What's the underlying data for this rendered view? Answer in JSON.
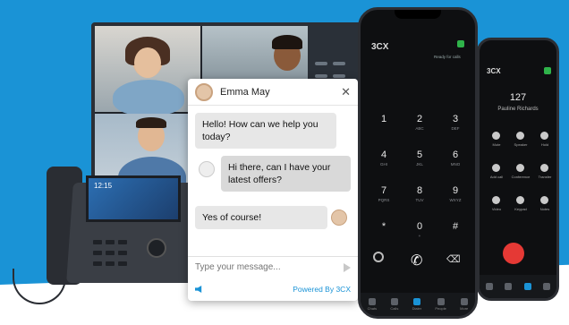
{
  "chat": {
    "agent_name": "Emma May",
    "close_glyph": "✕",
    "messages": [
      {
        "from": "agent",
        "text": "Hello! How can we help you today?"
      },
      {
        "from": "visitor",
        "text": "Hi there, can I have your latest offers?"
      },
      {
        "from": "agent",
        "text": "Yes of course!"
      }
    ],
    "input_placeholder": "Type your message...",
    "powered_by": "Powered By 3CX"
  },
  "desk_phone": {
    "screen_time": "12:15"
  },
  "main_phone": {
    "brand": "3CX",
    "status": "Ready for calls",
    "keys": [
      {
        "digit": "1",
        "letters": ""
      },
      {
        "digit": "2",
        "letters": "ABC"
      },
      {
        "digit": "3",
        "letters": "DEF"
      },
      {
        "digit": "4",
        "letters": "GHI"
      },
      {
        "digit": "5",
        "letters": "JKL"
      },
      {
        "digit": "6",
        "letters": "MNO"
      },
      {
        "digit": "7",
        "letters": "PQRS"
      },
      {
        "digit": "8",
        "letters": "TUV"
      },
      {
        "digit": "9",
        "letters": "WXYZ"
      },
      {
        "digit": "*",
        "letters": ""
      },
      {
        "digit": "0",
        "letters": "+"
      },
      {
        "digit": "#",
        "letters": ""
      }
    ],
    "tabs": [
      "Chats",
      "Calls",
      "Dialer",
      "People",
      "More"
    ]
  },
  "back_phone": {
    "brand": "3CX",
    "extension": "127",
    "caller_name": "Pauline Richards",
    "actions": [
      "Mute",
      "Speaker",
      "Hold",
      "Add call",
      "Conference",
      "Transfer",
      "Video",
      "Keypad",
      "Notes"
    ]
  },
  "colors": {
    "brand_blue": "#1a93d6",
    "hangup_red": "#e53935",
    "status_green": "#2fb34a"
  }
}
